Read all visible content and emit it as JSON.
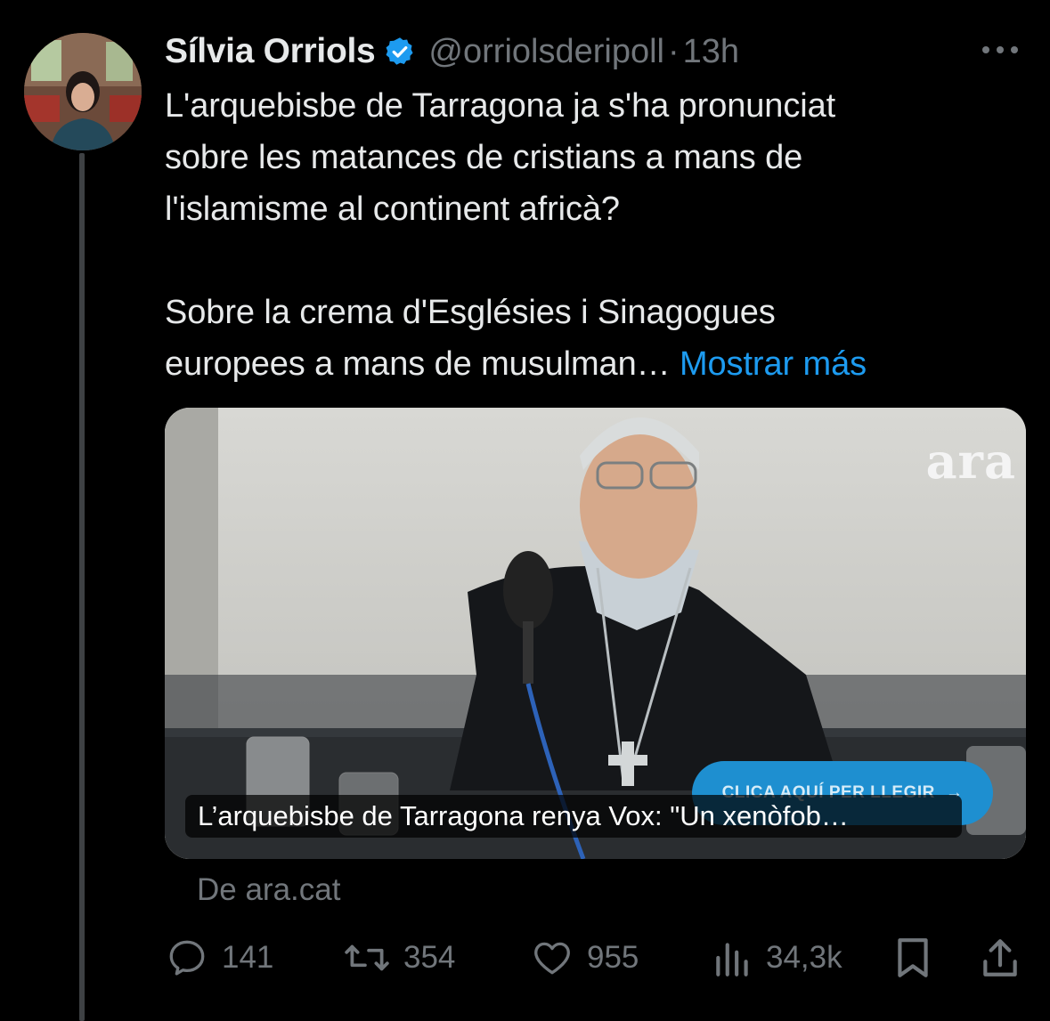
{
  "author": {
    "name": "Sílvia Orriols",
    "handle": "@orriolsderipoll",
    "separator": "·",
    "time": "13h",
    "verified_icon": "verified-badge-icon"
  },
  "body": {
    "paragraph1": [
      "L'arquebisbe de Tarragona ja s'ha pronunciat",
      "sobre les matances de cristians a mans de",
      "l'islamisme al continent africà?"
    ],
    "paragraph2_line1": "Sobre la crema d'Esglésies i Sinagogues",
    "paragraph2_line2": "europees a mans de musulman…",
    "show_more": "Mostrar más"
  },
  "card": {
    "logo": "ara",
    "cta": "CLICA AQUÍ PER LLEGIR",
    "cta_arrow": "→",
    "caption": "L’arquebisbe de Tarragona renya Vox: \"Un xenòfob…"
  },
  "source": "De ara.cat",
  "actions": {
    "replies": "141",
    "reposts": "354",
    "likes": "955",
    "views": "34,3k"
  },
  "colors": {
    "background": "#000000",
    "text": "#e7e9ea",
    "secondary": "#71767b",
    "accent": "#1d9bf0"
  }
}
